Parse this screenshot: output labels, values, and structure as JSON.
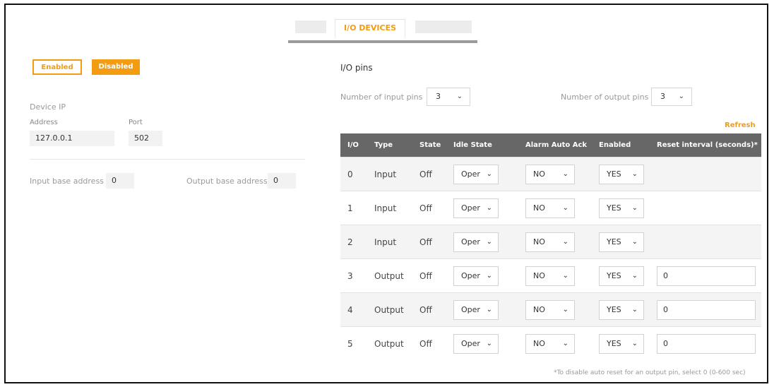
{
  "tabs": {
    "active_label": "I/O DEVICES"
  },
  "device": {
    "enabled_label": "Enabled",
    "disabled_label": "Disabled",
    "device_ip_label": "Device IP",
    "address_label": "Address",
    "address_value": "127.0.0.1",
    "port_label": "Port",
    "port_value": "502",
    "input_base_label": "Input base address",
    "input_base_value": "0",
    "output_base_label": "Output base address",
    "output_base_value": "0"
  },
  "pins": {
    "title": "I/O pins",
    "input_count_label": "Number of input pins",
    "input_count_value": "3",
    "output_count_label": "Number of output pins",
    "output_count_value": "3",
    "refresh_label": "Refresh",
    "columns": [
      "I/O",
      "Type",
      "State",
      "Idle State",
      "Alarm Auto Ack",
      "Enabled",
      "Reset interval (seconds)*"
    ],
    "rows": [
      {
        "io": "0",
        "type": "Input",
        "state": "Off",
        "idle": "Oper",
        "ack": "NO",
        "enabled": "YES",
        "reset": ""
      },
      {
        "io": "1",
        "type": "Input",
        "state": "Off",
        "idle": "Oper",
        "ack": "NO",
        "enabled": "YES",
        "reset": ""
      },
      {
        "io": "2",
        "type": "Input",
        "state": "Off",
        "idle": "Oper",
        "ack": "NO",
        "enabled": "YES",
        "reset": ""
      },
      {
        "io": "3",
        "type": "Output",
        "state": "Off",
        "idle": "Oper",
        "ack": "NO",
        "enabled": "YES",
        "reset": "0"
      },
      {
        "io": "4",
        "type": "Output",
        "state": "Off",
        "idle": "Oper",
        "ack": "NO",
        "enabled": "YES",
        "reset": "0"
      },
      {
        "io": "5",
        "type": "Output",
        "state": "Off",
        "idle": "Oper",
        "ack": "NO",
        "enabled": "YES",
        "reset": "0"
      }
    ],
    "footnote": "*To disable auto reset for an output pin, select 0 (0-600 sec)"
  },
  "colors": {
    "accent": "#f39c12",
    "header": "#676767"
  }
}
